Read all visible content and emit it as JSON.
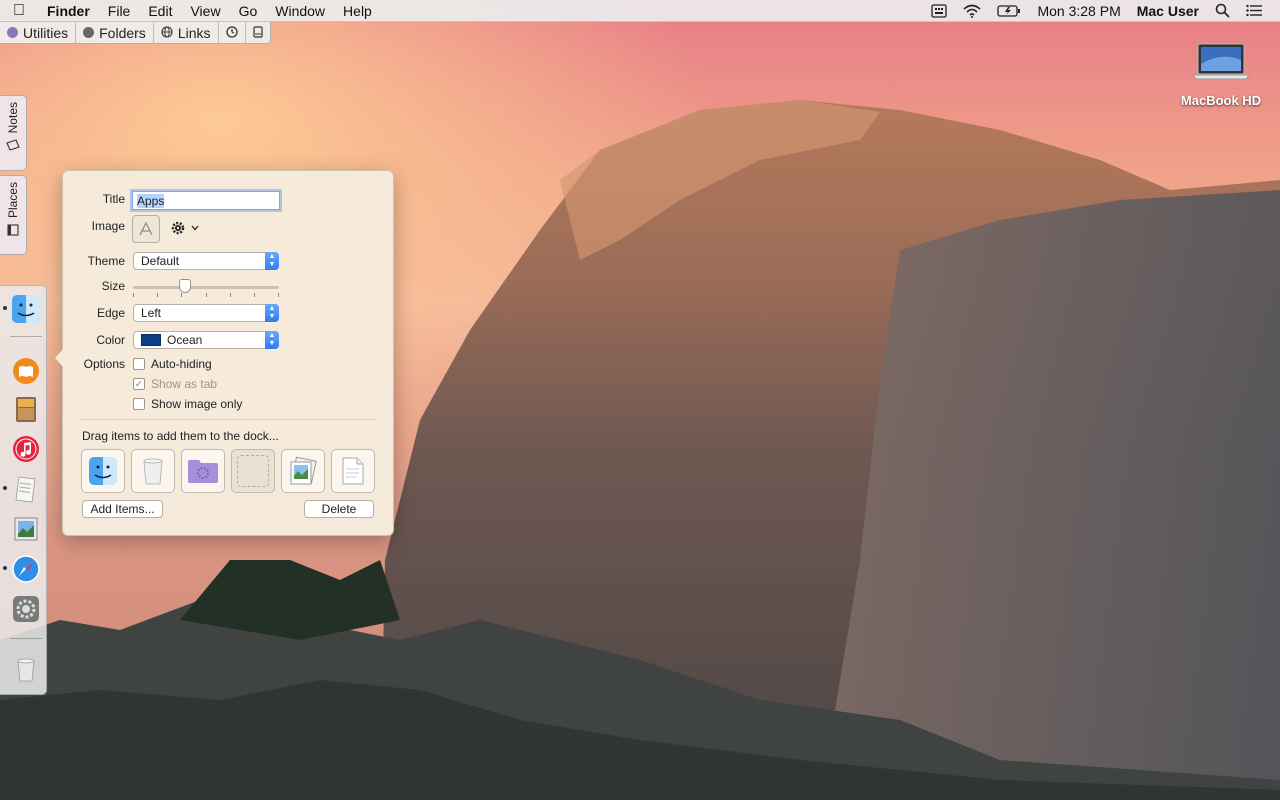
{
  "menubar": {
    "app": "Finder",
    "items": [
      "File",
      "Edit",
      "View",
      "Go",
      "Window",
      "Help"
    ],
    "clock": "Mon 3:28 PM",
    "user": "Mac User"
  },
  "tabbar": {
    "tabs": [
      {
        "label": "Utilities",
        "dot_color": "#8a78b8"
      },
      {
        "label": "Folders",
        "dot_color": "#666666"
      },
      {
        "label": "Links",
        "dot_color": "#666666"
      }
    ]
  },
  "sidetabs": {
    "notes": "Notes",
    "places": "Places"
  },
  "popover": {
    "title_label": "Title",
    "title_value": "Apps",
    "image_label": "Image",
    "theme_label": "Theme",
    "theme_value": "Default",
    "size_label": "Size",
    "size_fraction": 0.34,
    "edge_label": "Edge",
    "edge_value": "Left",
    "color_label": "Color",
    "color_value": "Ocean",
    "color_swatch": "#0b3f87",
    "options_label": "Options",
    "opt_autohide": "Auto-hiding",
    "opt_showtab": "Show as tab",
    "opt_imageonly": "Show image only",
    "hint": "Drag items to add them to the dock...",
    "add_button": "Add Items...",
    "delete_button": "Delete"
  },
  "desktop": {
    "drive_label": "MacBook HD"
  }
}
